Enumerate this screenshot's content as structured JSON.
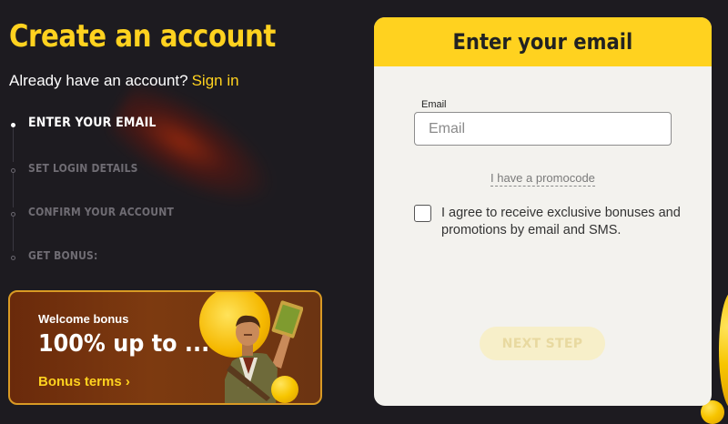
{
  "page": {
    "title": "Create an account",
    "signin_prompt": "Already have an account?",
    "signin_link": "Sign in"
  },
  "steps": [
    {
      "label": "ENTER YOUR EMAIL",
      "active": true
    },
    {
      "label": "SET LOGIN DETAILS",
      "active": false
    },
    {
      "label": "CONFIRM YOUR ACCOUNT",
      "active": false
    },
    {
      "label": "GET BONUS:",
      "active": false
    }
  ],
  "bonus": {
    "heading": "Welcome bonus",
    "amount": "100% up to ...",
    "terms_link": "Bonus terms ›"
  },
  "form": {
    "title": "Enter your email",
    "email_label": "Email",
    "email_placeholder": "Email",
    "email_value": "",
    "promo_link": "I have a promocode",
    "agree_text": "I agree to receive exclusive bonuses and promotions by email and SMS.",
    "agree_checked": false,
    "next_button": "NEXT STEP"
  },
  "colors": {
    "background": "#1d1b20",
    "accent_yellow": "#ffd21f",
    "card_background": "#f3f2ee",
    "bonus_border": "#d99a24",
    "button_disabled": "#f7efc9"
  },
  "icons": {
    "step_bullet": "dot-icon",
    "bonus_character": "explorer-character-icon",
    "terms_arrow": "chevron-right-icon"
  }
}
